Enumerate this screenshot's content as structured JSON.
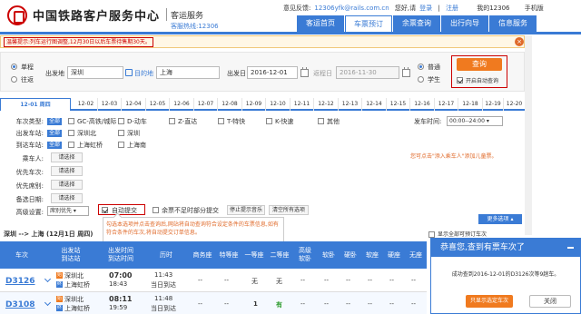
{
  "header": {
    "logo_text": "中国铁路客户服务中心",
    "logo_sub": "客运服务",
    "hotline": "客服热线:12306",
    "feedback": "意见反馈:",
    "feedback_email": "12306yfk@rails.com.cn",
    "greet": "您好,请",
    "login": "登录",
    "register": "注册",
    "my12306": "我的12306",
    "mobile": "手机版",
    "nav": [
      "客运首页",
      "车票预订",
      "余票查询",
      "出行向导",
      "信息服务"
    ],
    "nav_active": 1
  },
  "notice": {
    "text": "温馨提示:列车运行图调整,12月30日以后车票待售期30天。"
  },
  "query": {
    "trip_single": "单程",
    "trip_round": "往返",
    "from_label": "出发地",
    "from_value": "深圳",
    "to_label": "目的地",
    "to_value": "上海",
    "date_label": "出发日",
    "date_value": "2016-12-01",
    "return_label": "返程日",
    "return_value": "2016-11-30",
    "ticket_normal": "普通",
    "ticket_student": "学生",
    "query_button": "查询",
    "auto_query": "开启自动查询"
  },
  "dates": [
    "12-01 周四",
    "12-02",
    "12-03",
    "12-04",
    "12-05",
    "12-06",
    "12-07",
    "12-08",
    "12-09",
    "12-10",
    "12-11",
    "12-12",
    "12-13",
    "12-14",
    "12-15",
    "12-16",
    "12-17",
    "12-18",
    "12-19",
    "12-20"
  ],
  "filters": {
    "train_type_label": "车次类型:",
    "all": "全部",
    "train_types": [
      "GC-高铁/城际",
      "D-动车",
      "Z-直达",
      "T-特快",
      "K-快速",
      "其他"
    ],
    "dep_time_label": "发车时间:",
    "dep_time_value": "00:00--24:00",
    "from_station_label": "出发车站:",
    "from_stations": [
      "深圳北",
      "深圳"
    ],
    "to_station_label": "到达车站:",
    "to_stations": [
      "上海虹桥",
      "上海南"
    ],
    "passenger_label": "乘车人:",
    "pri_train_label": "优先车次:",
    "pri_seat_label": "优先席别:",
    "alt_date_label": "备选日期:",
    "select_btn": "请选择",
    "hint": "您可点击\"添入乘车人\"添加儿童票。",
    "advanced_label": "高级设置:",
    "submit_mode": "席别优先",
    "auto_submit": "自动提交",
    "partial_submit": "余票不足时部分提交",
    "stop_refresh": "停止提示音乐",
    "clear_opts": "清空所有选项",
    "tooltip": "勾选本选项并点击查询后,网站将自动查询符合设定条件的车票信息,如有符合条件的车次,将自动提交订单信息。",
    "more": "更多选项"
  },
  "results": {
    "summary": "深圳 --> 上海 (12月1日 周四)",
    "show_all": "显示全部可预订车次",
    "columns": [
      "车次",
      "出发站\n到达站",
      "出发时间\n到达时间",
      "历时",
      "商务座",
      "特等座",
      "一等座",
      "二等座",
      "高级\n软卧",
      "软卧",
      "硬卧",
      "软座",
      "硬座",
      "无座"
    ],
    "rows": [
      {
        "train": "D3126",
        "from": "深圳北",
        "to": "上海虹桥",
        "dep": "07:00",
        "arr": "18:43",
        "dur": "11:43",
        "dur2": "当日到达",
        "biz": "--",
        "spec": "--",
        "first": "无",
        "second": "无",
        "gsw": "--",
        "sw": "--",
        "yw": "--",
        "rz": "--",
        "yz": "--",
        "wz": "--"
      },
      {
        "train": "D3108",
        "from": "深圳北",
        "to": "上海虹桥",
        "dep": "08:11",
        "arr": "19:59",
        "dur": "11:48",
        "dur2": "当日到达",
        "biz": "--",
        "spec": "--",
        "first": "1",
        "second": "有",
        "gsw": "--",
        "sw": "--",
        "yw": "--",
        "rz": "--",
        "yz": "--",
        "wz": "--"
      }
    ]
  },
  "popup": {
    "title": "恭喜您,查到有票车次了",
    "message": "成功查到2016-12-01的D3126次等9趟车。",
    "select_btn": "只显示选定车次",
    "close_btn": "关闭"
  },
  "colors": {
    "accent": "#3a7bd5",
    "orange": "#f07a1f",
    "red": "#cc0000"
  }
}
